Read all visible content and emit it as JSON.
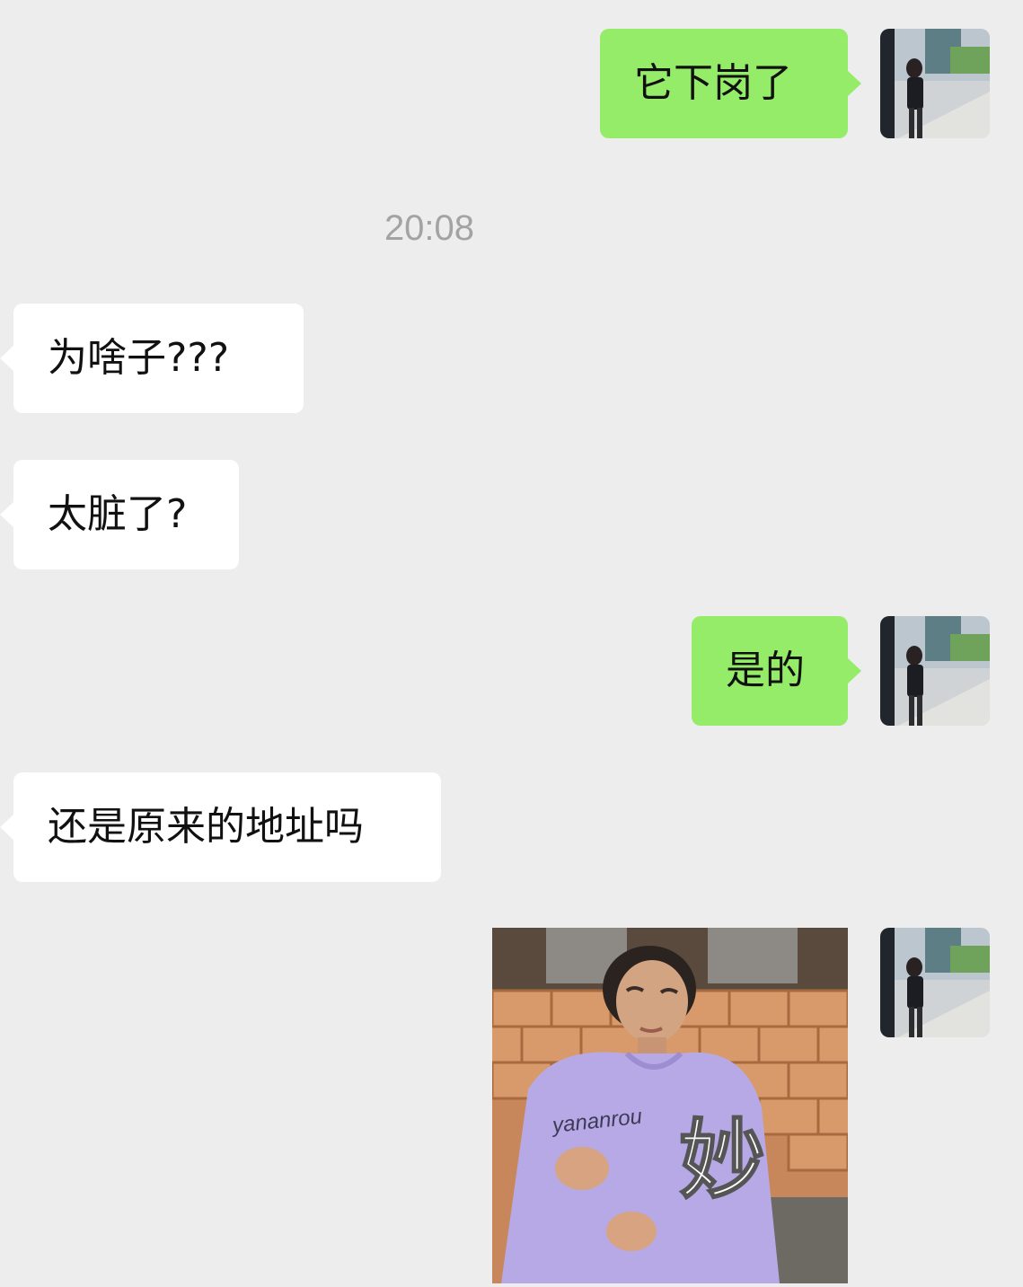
{
  "timestamp": "20:08",
  "messages": [
    {
      "direction": "out",
      "text": "它下岗了"
    },
    {
      "direction": "in",
      "text": "为啥子???"
    },
    {
      "direction": "in",
      "text": "太脏了?"
    },
    {
      "direction": "out",
      "text": "是的"
    },
    {
      "direction": "in",
      "text": "还是原来的地址吗"
    },
    {
      "direction": "out",
      "type": "sticker",
      "sticker_caption": "妙",
      "shirt_text": "yananrou"
    }
  ],
  "colors": {
    "background": "#ededed",
    "outgoing_bubble": "#95ec69",
    "incoming_bubble": "#ffffff",
    "timestamp_text": "#a3a3a3"
  },
  "icons": {
    "avatar": "user-avatar-photo",
    "sticker": "meme-sticker-image"
  }
}
